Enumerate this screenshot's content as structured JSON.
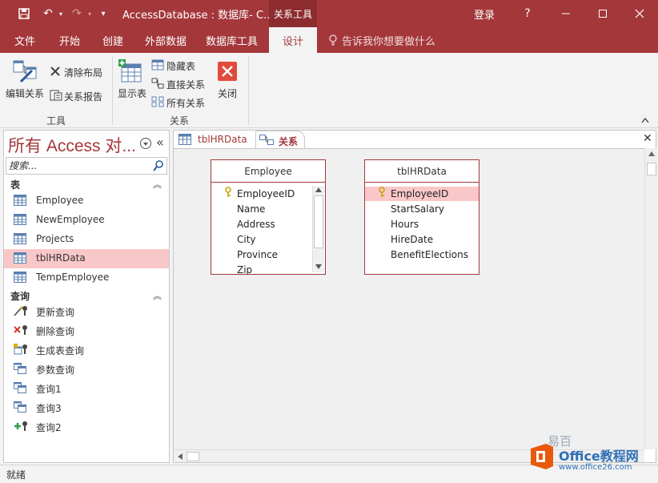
{
  "window": {
    "title": "AccessDatabase : 数据库- C...",
    "context_tab": "关系工具",
    "login": "登录",
    "help": "?"
  },
  "ribbon_tabs": [
    "文件",
    "开始",
    "创建",
    "外部数据",
    "数据库工具",
    "设计"
  ],
  "tell_me": "告诉我你想要做什么",
  "ribbon": {
    "edit_relationships": "编辑关系",
    "clear_layout": "清除布局",
    "relationship_report": "关系报告",
    "group_tools": "工具",
    "show_table": "显示表",
    "hide_table": "隐藏表",
    "direct_relationships": "直接关系",
    "all_relationships": "所有关系",
    "close": "关闭",
    "group_relationships": "关系"
  },
  "nav": {
    "title": "所有 Access 对...",
    "search_placeholder": "搜索...",
    "tables_header": "表",
    "tables": [
      "Employee",
      "NewEmployee",
      "Projects",
      "tblHRData",
      "TempEmployee"
    ],
    "queries_header": "查询",
    "queries": [
      "更新查询",
      "删除查询",
      "生成表查询",
      "参数查询",
      "查询1",
      "查询3",
      "查询2"
    ]
  },
  "doc_tabs": [
    "tblHRData",
    "关系"
  ],
  "tables": [
    {
      "name": "Employee",
      "fields": [
        "EmployeeID",
        "Name",
        "Address",
        "City",
        "Province",
        "Zip"
      ]
    },
    {
      "name": "tblHRData",
      "fields": [
        "EmployeeID",
        "StartSalary",
        "Hours",
        "HireDate",
        "BenefitElections"
      ]
    }
  ],
  "status": "就绪",
  "watermark": {
    "brand": "Office教程网",
    "url": "www.office26.com",
    "small": "易百"
  },
  "colors": {
    "accent": "#a4373a",
    "selection": "#f9c7c8"
  }
}
